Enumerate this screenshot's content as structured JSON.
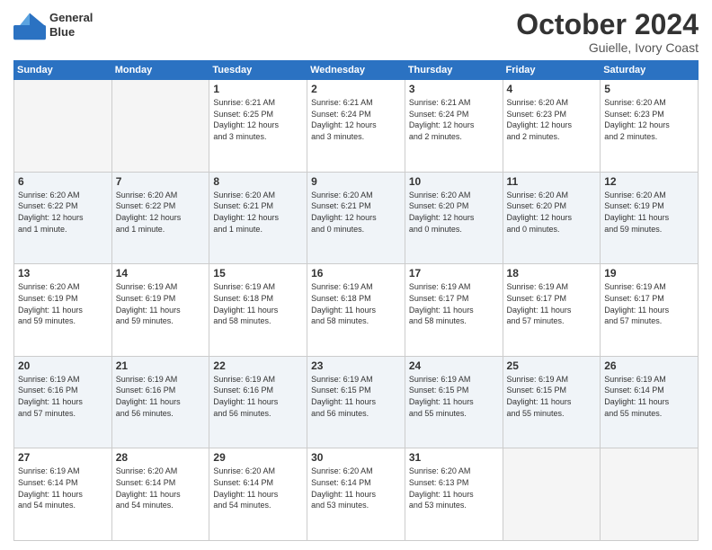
{
  "header": {
    "logo_line1": "General",
    "logo_line2": "Blue",
    "month": "October 2024",
    "location": "Guielle, Ivory Coast"
  },
  "weekdays": [
    "Sunday",
    "Monday",
    "Tuesday",
    "Wednesday",
    "Thursday",
    "Friday",
    "Saturday"
  ],
  "weeks": [
    [
      {
        "day": "",
        "info": ""
      },
      {
        "day": "",
        "info": ""
      },
      {
        "day": "1",
        "info": "Sunrise: 6:21 AM\nSunset: 6:25 PM\nDaylight: 12 hours\nand 3 minutes."
      },
      {
        "day": "2",
        "info": "Sunrise: 6:21 AM\nSunset: 6:24 PM\nDaylight: 12 hours\nand 3 minutes."
      },
      {
        "day": "3",
        "info": "Sunrise: 6:21 AM\nSunset: 6:24 PM\nDaylight: 12 hours\nand 2 minutes."
      },
      {
        "day": "4",
        "info": "Sunrise: 6:20 AM\nSunset: 6:23 PM\nDaylight: 12 hours\nand 2 minutes."
      },
      {
        "day": "5",
        "info": "Sunrise: 6:20 AM\nSunset: 6:23 PM\nDaylight: 12 hours\nand 2 minutes."
      }
    ],
    [
      {
        "day": "6",
        "info": "Sunrise: 6:20 AM\nSunset: 6:22 PM\nDaylight: 12 hours\nand 1 minute."
      },
      {
        "day": "7",
        "info": "Sunrise: 6:20 AM\nSunset: 6:22 PM\nDaylight: 12 hours\nand 1 minute."
      },
      {
        "day": "8",
        "info": "Sunrise: 6:20 AM\nSunset: 6:21 PM\nDaylight: 12 hours\nand 1 minute."
      },
      {
        "day": "9",
        "info": "Sunrise: 6:20 AM\nSunset: 6:21 PM\nDaylight: 12 hours\nand 0 minutes."
      },
      {
        "day": "10",
        "info": "Sunrise: 6:20 AM\nSunset: 6:20 PM\nDaylight: 12 hours\nand 0 minutes."
      },
      {
        "day": "11",
        "info": "Sunrise: 6:20 AM\nSunset: 6:20 PM\nDaylight: 12 hours\nand 0 minutes."
      },
      {
        "day": "12",
        "info": "Sunrise: 6:20 AM\nSunset: 6:19 PM\nDaylight: 11 hours\nand 59 minutes."
      }
    ],
    [
      {
        "day": "13",
        "info": "Sunrise: 6:20 AM\nSunset: 6:19 PM\nDaylight: 11 hours\nand 59 minutes."
      },
      {
        "day": "14",
        "info": "Sunrise: 6:19 AM\nSunset: 6:19 PM\nDaylight: 11 hours\nand 59 minutes."
      },
      {
        "day": "15",
        "info": "Sunrise: 6:19 AM\nSunset: 6:18 PM\nDaylight: 11 hours\nand 58 minutes."
      },
      {
        "day": "16",
        "info": "Sunrise: 6:19 AM\nSunset: 6:18 PM\nDaylight: 11 hours\nand 58 minutes."
      },
      {
        "day": "17",
        "info": "Sunrise: 6:19 AM\nSunset: 6:17 PM\nDaylight: 11 hours\nand 58 minutes."
      },
      {
        "day": "18",
        "info": "Sunrise: 6:19 AM\nSunset: 6:17 PM\nDaylight: 11 hours\nand 57 minutes."
      },
      {
        "day": "19",
        "info": "Sunrise: 6:19 AM\nSunset: 6:17 PM\nDaylight: 11 hours\nand 57 minutes."
      }
    ],
    [
      {
        "day": "20",
        "info": "Sunrise: 6:19 AM\nSunset: 6:16 PM\nDaylight: 11 hours\nand 57 minutes."
      },
      {
        "day": "21",
        "info": "Sunrise: 6:19 AM\nSunset: 6:16 PM\nDaylight: 11 hours\nand 56 minutes."
      },
      {
        "day": "22",
        "info": "Sunrise: 6:19 AM\nSunset: 6:16 PM\nDaylight: 11 hours\nand 56 minutes."
      },
      {
        "day": "23",
        "info": "Sunrise: 6:19 AM\nSunset: 6:15 PM\nDaylight: 11 hours\nand 56 minutes."
      },
      {
        "day": "24",
        "info": "Sunrise: 6:19 AM\nSunset: 6:15 PM\nDaylight: 11 hours\nand 55 minutes."
      },
      {
        "day": "25",
        "info": "Sunrise: 6:19 AM\nSunset: 6:15 PM\nDaylight: 11 hours\nand 55 minutes."
      },
      {
        "day": "26",
        "info": "Sunrise: 6:19 AM\nSunset: 6:14 PM\nDaylight: 11 hours\nand 55 minutes."
      }
    ],
    [
      {
        "day": "27",
        "info": "Sunrise: 6:19 AM\nSunset: 6:14 PM\nDaylight: 11 hours\nand 54 minutes."
      },
      {
        "day": "28",
        "info": "Sunrise: 6:20 AM\nSunset: 6:14 PM\nDaylight: 11 hours\nand 54 minutes."
      },
      {
        "day": "29",
        "info": "Sunrise: 6:20 AM\nSunset: 6:14 PM\nDaylight: 11 hours\nand 54 minutes."
      },
      {
        "day": "30",
        "info": "Sunrise: 6:20 AM\nSunset: 6:14 PM\nDaylight: 11 hours\nand 53 minutes."
      },
      {
        "day": "31",
        "info": "Sunrise: 6:20 AM\nSunset: 6:13 PM\nDaylight: 11 hours\nand 53 minutes."
      },
      {
        "day": "",
        "info": ""
      },
      {
        "day": "",
        "info": ""
      }
    ]
  ]
}
